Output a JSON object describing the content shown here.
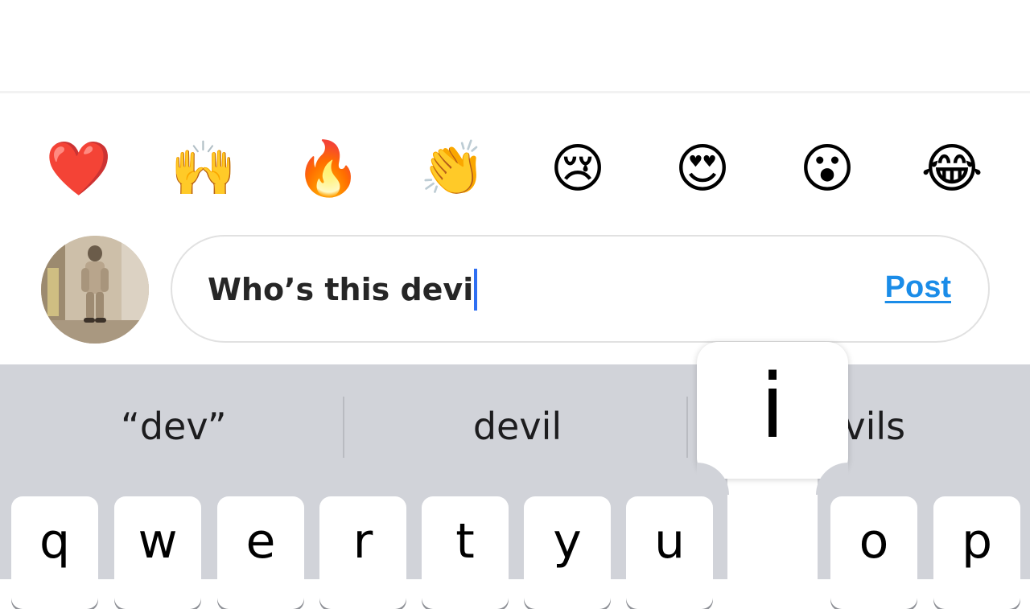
{
  "reactions": [
    {
      "name": "red-heart-icon",
      "glyph": "❤️"
    },
    {
      "name": "raising-hands-icon",
      "glyph": "🙌"
    },
    {
      "name": "fire-icon",
      "glyph": "🔥"
    },
    {
      "name": "clapping-hands-icon",
      "glyph": "👏"
    },
    {
      "name": "crying-face-icon",
      "glyph": "😢"
    },
    {
      "name": "heart-eyes-face-icon",
      "glyph": "😍"
    },
    {
      "name": "surprised-face-icon",
      "glyph": "😮"
    },
    {
      "name": "tears-of-joy-face-icon",
      "glyph": "😂"
    }
  ],
  "comment": {
    "text": "Who’s this devi",
    "post_label": "Post",
    "post_color": "#1a8ce8"
  },
  "keyboard": {
    "suggestions": [
      "“dev”",
      "devil",
      "devils"
    ],
    "popup_key": "i",
    "keys": [
      "q",
      "w",
      "e",
      "r",
      "t",
      "y",
      "u",
      "o",
      "p"
    ],
    "background": "#d1d3d9"
  }
}
